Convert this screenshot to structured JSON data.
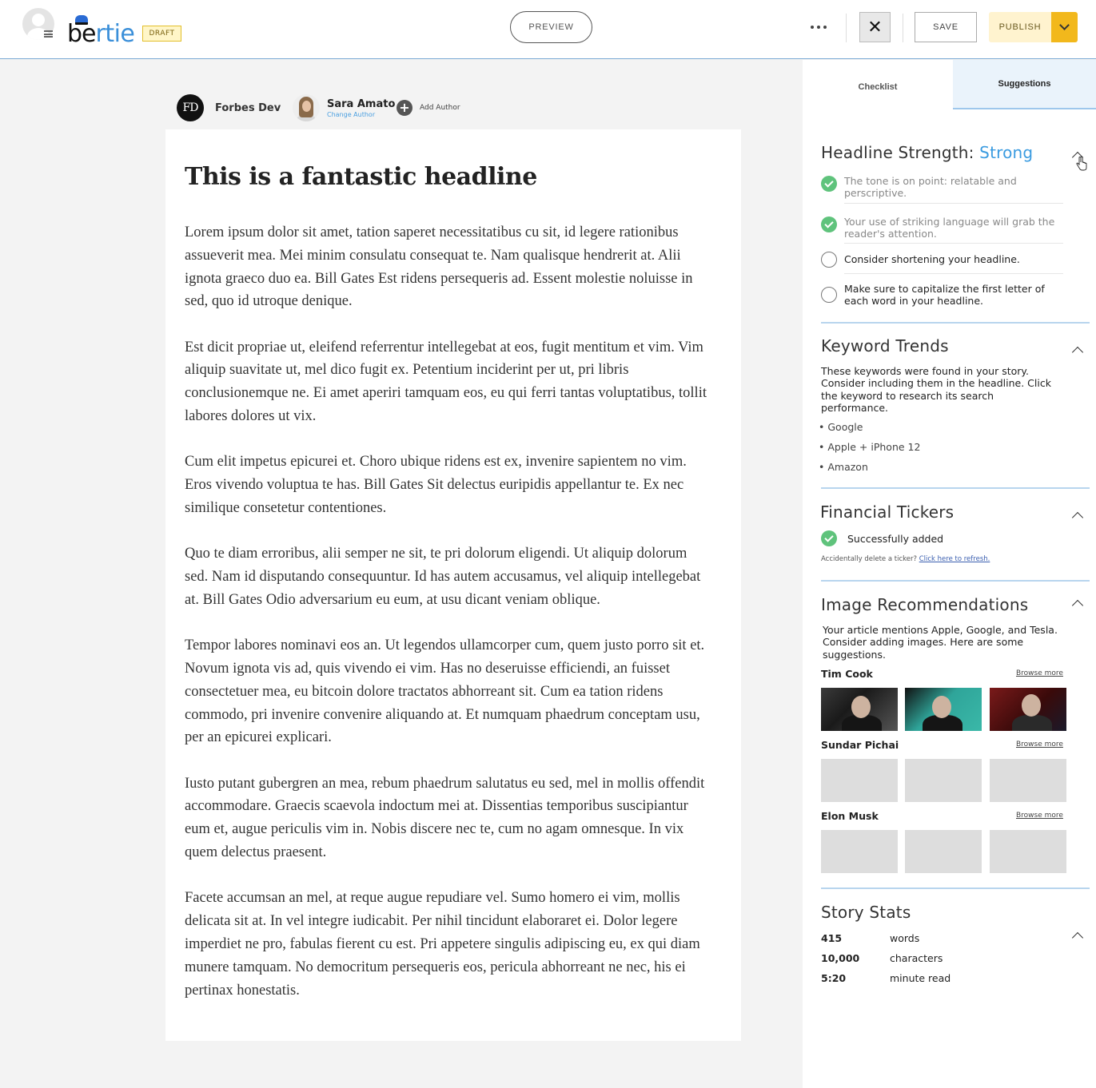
{
  "header": {
    "logo_text_b": "be",
    "logo_text_rest": "rtie",
    "draft_badge": "DRAFT",
    "preview_label": "PREVIEW",
    "save_label": "SAVE",
    "publish_label": "PUBLISH",
    "accent_color": "#f2b81c"
  },
  "authors": {
    "primary": {
      "initials": "FD",
      "name": "Forbes Dev"
    },
    "secondary": {
      "name": "Sara Amato",
      "change_label": "Change Author"
    },
    "add_label": "Add Author"
  },
  "article": {
    "headline": "This is a fantastic headline",
    "paragraphs": [
      "Lorem ipsum dolor sit amet, tation saperet necessitatibus cu sit, id legere rationibus assueverit mea. Mei minim consulatu consequat te. Nam qualisque hendrerit at. Alii ignota graeco duo ea. Bill Gates Est ridens persequeris ad. Essent molestie noluisse in sed, quo id utroque denique.",
      "Est dicit propriae ut, eleifend referrentur intellegebat at eos, fugit mentitum et vim. Vim aliquip suavitate ut, mel dico fugit ex. Petentium inciderint per ut, pri libris conclusionemque ne. Ei amet aperiri tamquam eos, eu qui ferri tantas voluptatibus, tollit labores dolores ut vix.",
      "Cum elit impetus epicurei et. Choro ubique ridens est ex, invenire sapientem no vim. Eros vivendo voluptua te has. Bill Gates Sit delectus euripidis appellantur te. Ex nec similique consetetur contentiones.",
      "Quo te diam erroribus, alii semper ne sit, te pri dolorum eligendi. Ut aliquip dolorum sed. Nam id disputando consequuntur. Id has autem accusamus, vel aliquip intellegebat at. Bill Gates Odio adversarium eu eum, at usu dicant veniam oblique.",
      "Tempor labores nominavi eos an. Ut legendos ullamcorper cum, quem justo porro sit et. Novum ignota vis ad, quis vivendo ei vim. Has no deseruisse efficiendi, an fuisset consectetuer mea, eu bitcoin dolore tractatos abhorreant sit. Cum ea tation ridens commodo, pri invenire convenire aliquando at. Et numquam phaedrum conceptam usu, per an epicurei explicari.",
      "Iusto putant gubergren an mea, rebum phaedrum salutatus eu sed, mel in mollis offendit accommodare. Graecis scaevola indoctum mei at. Dissentias temporibus suscipiantur eum et, augue periculis vim in. Nobis discere nec te, cum no agam omnesque. In vix quem delectus praesent.",
      "Facete accumsan an mel, at reque augue repudiare vel. Sumo homero ei vim, mollis delicata sit at. In vel integre iudicabit. Per nihil tincidunt elaboraret ei. Dolor legere imperdiet ne pro, fabulas fierent cu est. Pri appetere singulis adipiscing eu, ex qui diam munere tamquam. No democritum persequeris eos, pericula abhorreant ne nec, his ei pertinax honestatis."
    ]
  },
  "panel": {
    "tabs": [
      {
        "label": "Checklist"
      },
      {
        "label": "Suggestions"
      }
    ],
    "headline_strength": {
      "title": "Headline Strength:",
      "rating": "Strong",
      "rating_color": "#3a9be0",
      "items": [
        {
          "text": "The tone is on point: relatable and perscriptive.",
          "done": true
        },
        {
          "text": "Your use of striking language will grab the reader's attention.",
          "done": true
        },
        {
          "text": "Consider shortening your headline.",
          "done": false
        },
        {
          "text": "Make sure to capitalize the first letter of each word in your headline.",
          "done": false
        }
      ]
    },
    "keyword_trends": {
      "title": "Keyword Trends",
      "description": "These keywords were found in your story. Consider including them in the headline. Click the keyword to research its search performance.",
      "keywords": [
        "Google",
        "Apple + iPhone 12",
        "Amazon"
      ]
    },
    "financial_tickers": {
      "title": "Financial Tickers",
      "status": "Successfully added",
      "note_prefix": "Accidentally delete a ticker?",
      "note_link": "Click here to refresh."
    },
    "image_recommendations": {
      "title": "Image Recommendations",
      "description": "Your article mentions Apple, Google, and Tesla. Consider adding images. Here are some suggestions.",
      "browse_label": "Browse more",
      "people": [
        {
          "name": "Tim Cook"
        },
        {
          "name": "Sundar Pichai"
        },
        {
          "name": "Elon Musk"
        }
      ]
    },
    "story_stats": {
      "title": "Story Stats",
      "stats": [
        {
          "value": "415",
          "label": "words"
        },
        {
          "value": "10,000",
          "label": "characters"
        },
        {
          "value": "5:20",
          "label": "minute read"
        }
      ]
    }
  }
}
